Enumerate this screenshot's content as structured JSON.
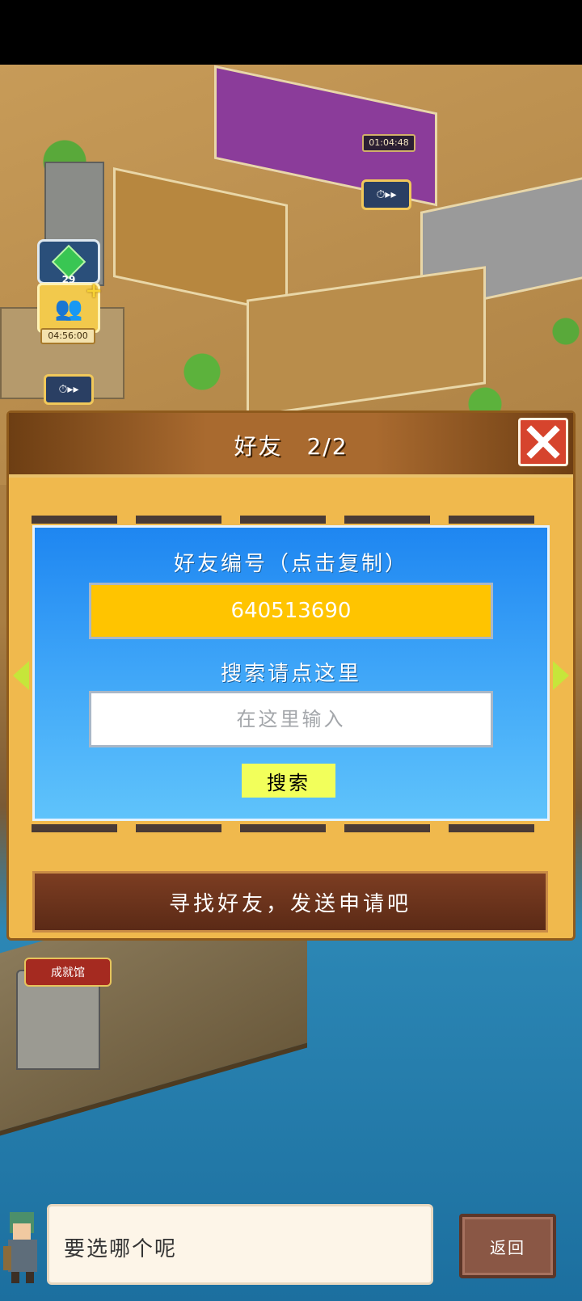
{
  "hud": {
    "gem_count": "29",
    "event_timer": "04:56:00",
    "room_timer": "01:04:48",
    "fast_forward_icon": "clock-fast-forward-icon"
  },
  "map": {
    "museum_sign": "成就馆"
  },
  "dialog": {
    "title": "好友",
    "count": "2/2",
    "close_icon": "close-icon",
    "friend_id_label": "好友编号（点击复制）",
    "friend_id": "640513690",
    "search_label": "搜索请点这里",
    "search_placeholder": "在这里输入",
    "search_button": "搜索",
    "banner_text": "寻找好友，发送申请吧"
  },
  "footer": {
    "message": "要选哪个呢",
    "back_button": "返回"
  },
  "colors": {
    "panel_blue": "#1e86f1",
    "id_yellow": "#ffc400",
    "search_button": "#f2ff5b",
    "close_red": "#d6442d",
    "banner_brown": "#6b321b"
  }
}
